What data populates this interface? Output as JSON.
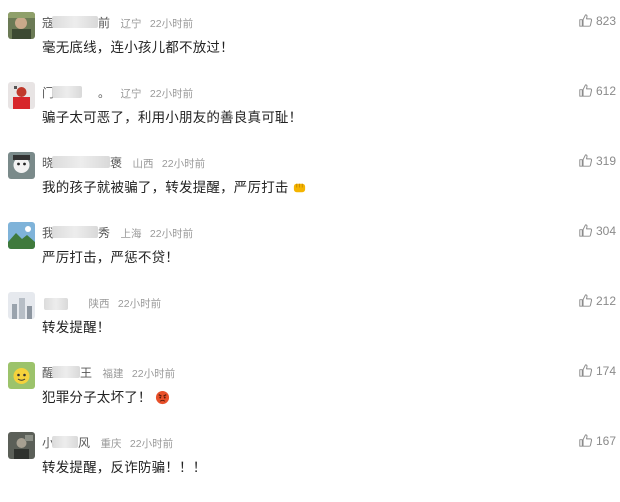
{
  "comments": [
    {
      "name_first": "寇",
      "name_last": "前",
      "location": "辽宁",
      "time": "22小时前",
      "text": "毫无底线，连小孩儿都不放过！",
      "likes": "823",
      "avatar_icon": "avatar-photo-icon",
      "emoji": ""
    },
    {
      "name_first": "门",
      "name_last": "。",
      "location": "辽宁",
      "time": "22小时前",
      "text": "骗子太可恶了，利用小朋友的善良真可耻！",
      "likes": "612",
      "avatar_icon": "avatar-red-icon",
      "emoji": ""
    },
    {
      "name_first": "晓",
      "name_last": "褒",
      "location": "山西",
      "time": "22小时前",
      "text": "我的孩子就被骗了，转发提醒，严厉打击",
      "likes": "319",
      "avatar_icon": "avatar-cartoon-icon",
      "emoji": "fist-emoji-icon"
    },
    {
      "name_first": "我",
      "name_last": "秀",
      "location": "上海",
      "time": "22小时前",
      "text": "严厉打击，严惩不贷！",
      "likes": "304",
      "avatar_icon": "avatar-landscape-icon",
      "emoji": ""
    },
    {
      "name_first": "",
      "name_last": "",
      "location": "陕西",
      "time": "22小时前",
      "text": "转发提醒！",
      "likes": "212",
      "avatar_icon": "avatar-city-icon",
      "emoji": ""
    },
    {
      "name_first": "醒",
      "name_last": "王",
      "location": "福建",
      "time": "22小时前",
      "text": "犯罪分子太坏了！",
      "likes": "174",
      "avatar_icon": "avatar-yellow-icon",
      "emoji": "angry-face-emoji-icon"
    },
    {
      "name_first": "小",
      "name_last": "风",
      "location": "重庆",
      "time": "22小时前",
      "text": "转发提醒，反诈防骗！！！",
      "likes": "167",
      "avatar_icon": "avatar-dark-icon",
      "emoji": ""
    }
  ]
}
